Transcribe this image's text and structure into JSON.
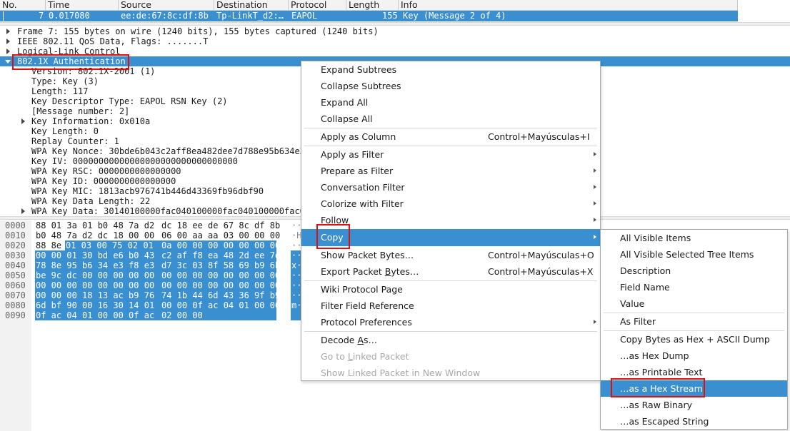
{
  "packet_list": {
    "columns": [
      "No.",
      "Time",
      "Source",
      "Destination",
      "Protocol",
      "Length",
      "Info"
    ],
    "row": {
      "no": "7",
      "time": "0.017080",
      "source": "ee:de:67:8c:df:8b",
      "destination": "Tp-LinkT_d2:…",
      "protocol": "EAPOL",
      "length": "155",
      "info": "Key (Message 2 of 4)"
    }
  },
  "details": {
    "lines": [
      "Frame 7: 155 bytes on wire (1240 bits), 155 bytes captured (1240 bits)",
      "IEEE 802.11 QoS Data, Flags: .......T",
      "Logical-Link Control",
      "802.1X Authentication",
      "Version: 802.1X-2001 (1)",
      "Type: Key (3)",
      "Length: 117",
      "Key Descriptor Type: EAPOL RSN Key (2)",
      "[Message number: 2]",
      "Key Information: 0x010a",
      "Key Length: 0",
      "Replay Counter: 1",
      "WPA Key Nonce: 30bde6b043c2aff8ea482dee7d788e95b634e3",
      "Key IV: 00000000000000000000000000000000",
      "WPA Key RSC: 0000000000000000",
      "WPA Key ID: 0000000000000000",
      "WPA Key MIC: 1813acb976741b446d43369fb96dbf90",
      "WPA Key Data Length: 22",
      "WPA Key Data: 30140100000fac040100000fac040100000fac0"
    ]
  },
  "bytes": {
    "offsets": [
      "0000",
      "0010",
      "0020",
      "0030",
      "0040",
      "0050",
      "0060",
      "0070",
      "0080",
      "0090"
    ],
    "rows": [
      {
        "a": "88 01 3a 01 b0 48 7a d2",
        "b": "dc 18 ee de 67 8c df 8b",
        "ascii": "··"
      },
      {
        "a": "b0 48 7a d2 dc 18 00 00",
        "b": "06 00 aa aa 03 00 00 00",
        "ascii": "·H"
      },
      {
        "a": "88 8e",
        "a2": "01 03 00 75 02 01",
        "b": "0a 00 00 00 00 00 00 00",
        "ascii": "··"
      },
      {
        "a": "00 00 01 30 bd e6 b0 43",
        "b": "c2 af f8 ea 48 2d ee 7d",
        "ascii": "··"
      },
      {
        "a": "78 8e 95 b6 34 e3 f8 e3",
        "b": "d7 3c 03 8f 58 69 b9 6b",
        "ascii": "x·"
      },
      {
        "a": "be 9c dc 00 00 00 00 00",
        "b": "00 00 00 00 00 00 00 00",
        "ascii": "··"
      },
      {
        "a": "00 00 00 00 00 00 00 00",
        "b": "00 00 00 00 00 00 00 00",
        "ascii": "··"
      },
      {
        "a": "00 00 00 18 13 ac b9 76",
        "b": "74 1b 44 6d 43 36 9f b9",
        "ascii": "··"
      },
      {
        "a": "6d bf 90 00 16 30 14 01",
        "b": "00 00 0f ac 04 01 00 00",
        "ascii": "m·"
      },
      {
        "a": "0f ac 04 01 00 00 0f ac",
        "b": "02 00 00",
        "ascii": ""
      }
    ]
  },
  "context_menu": {
    "expand_subtrees": "Expand Subtrees",
    "collapse_subtrees": "Collapse Subtrees",
    "expand_all": "Expand All",
    "collapse_all": "Collapse All",
    "apply_as_column": "Apply as Column",
    "apply_as_column_shortcut": "Control+Mayúsculas+I",
    "apply_as_filter": "Apply as Filter",
    "prepare_as_filter": "Prepare as Filter",
    "conversation_filter": "Conversation Filter",
    "colorize_with_filter": "Colorize with Filter",
    "follow": "Follow",
    "copy": "Copy",
    "show_packet_bytes": "Show Packet Bytes…",
    "show_packet_bytes_shortcut": "Control+Mayúsculas+O",
    "export_packet_bytes_pre": "Export Packet ",
    "export_packet_bytes_ul": "B",
    "export_packet_bytes_post": "ytes…",
    "export_packet_bytes_shortcut": "Control+Mayúsculas+X",
    "wiki_protocol_page": "Wiki Protocol Page",
    "filter_field_reference": "Filter Field Reference",
    "protocol_preferences": "Protocol Preferences",
    "decode_as_pre": "Decode ",
    "decode_as_ul": "A",
    "decode_as_post": "s…",
    "go_to_linked_packet_pre": "Go to ",
    "go_to_linked_packet_ul": "L",
    "go_to_linked_packet_post": "inked Packet",
    "show_linked_packet": "Show Linked Packet in New Window"
  },
  "copy_submenu": {
    "all_visible_items": "All Visible Items",
    "all_visible_selected_tree_items": "All Visible Selected Tree Items",
    "description": "Description",
    "field_name": "Field Name",
    "value": "Value",
    "as_filter": "As Filter",
    "copy_bytes_hex_ascii": "Copy Bytes as Hex + ASCII Dump",
    "as_hex_dump": "…as Hex Dump",
    "as_printable_text": "…as Printable Text",
    "as_hex_stream": "…as a Hex Stream",
    "as_raw_binary": "…as Raw Binary",
    "as_escaped_string": "…as Escaped String"
  },
  "colors": {
    "selection": "#3a8fd0",
    "highlight_box": "#e01010"
  }
}
